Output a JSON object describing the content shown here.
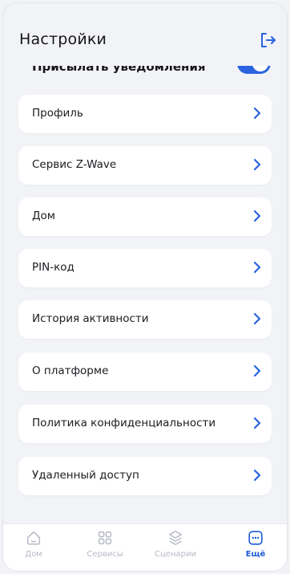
{
  "header": {
    "title": "Настройки"
  },
  "notifications": {
    "label": "Присылать уведомления",
    "enabled": true
  },
  "settings_items": [
    {
      "label": "Профиль"
    },
    {
      "label": "Сервис Z-Wave"
    },
    {
      "label": "Дом"
    },
    {
      "label": "PIN-код"
    },
    {
      "label": "История активности"
    },
    {
      "label": "О платформе"
    },
    {
      "label": "Политика конфиденциальности"
    },
    {
      "label": "Удаленный доступ"
    }
  ],
  "tabbar": {
    "tabs": [
      {
        "label": "Дом",
        "icon": "home-icon",
        "active": false
      },
      {
        "label": "Сервисы",
        "icon": "grid-icon",
        "active": false
      },
      {
        "label": "Сценарии",
        "icon": "layers-icon",
        "active": false
      },
      {
        "label": "Ещё",
        "icon": "more-icon",
        "active": true
      }
    ]
  },
  "colors": {
    "accent": "#2a63df",
    "background": "#f2f3f7",
    "card": "#ffffff",
    "inactive_tab": "#b7bac6"
  }
}
